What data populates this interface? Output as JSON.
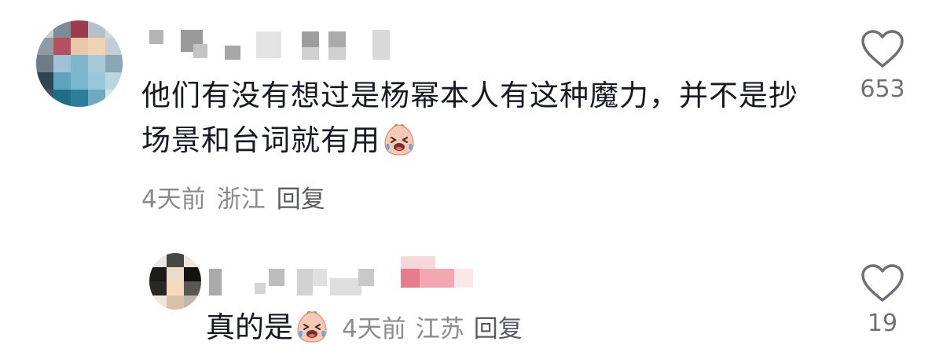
{
  "comment": {
    "text": "他们有没有想过是杨幂本人有这种魔力，并不是抄场景和台词就有用",
    "emoji": "laughing-crying-face-emoji",
    "time": "4天前",
    "location": "浙江",
    "reply_label": "回复",
    "like_count": "653"
  },
  "reply": {
    "text": "真的是",
    "emoji": "laughing-crying-face-emoji",
    "time": "4天前",
    "location": "江苏",
    "reply_label": "回复",
    "like_count": "19"
  },
  "icons": {
    "like": "heart-outline-icon"
  },
  "colors": {
    "primary_text": "#161823",
    "secondary_text": "#8a8b91",
    "like_icon": "#6f7077"
  }
}
